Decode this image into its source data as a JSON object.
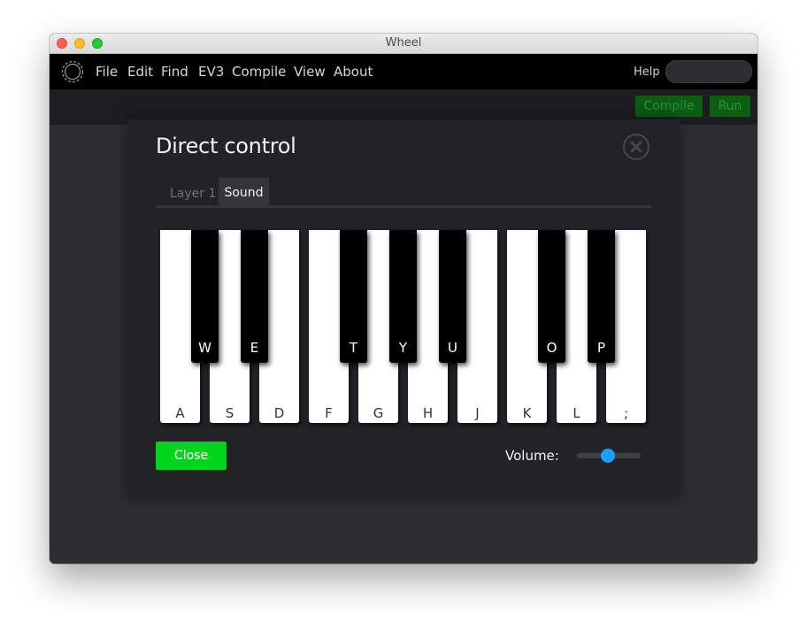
{
  "window": {
    "title": "Wheel"
  },
  "menu": {
    "items": [
      "File",
      "Edit",
      "Find",
      "EV3",
      "Compile",
      "View",
      "About"
    ],
    "help_label": "Help"
  },
  "toolbar": {
    "compile_label": "Compile",
    "run_label": "Run"
  },
  "dialog": {
    "title": "Direct control",
    "tabs": [
      {
        "label": "Layer 1",
        "active": false
      },
      {
        "label": "Sound",
        "active": true
      }
    ],
    "piano": {
      "white_keys": [
        "A",
        "S",
        "D",
        "F",
        "G",
        "H",
        "J",
        "K",
        "L",
        ";"
      ],
      "black_keys": [
        "W",
        "E",
        "T",
        "Y",
        "U",
        "O",
        "P"
      ]
    },
    "close_label": "Close",
    "volume_label": "Volume:",
    "volume_level": 0.48
  },
  "colors": {
    "close_button": "#00d51b",
    "slider_thumb": "#19a0ff",
    "toolbar_button": "#0b5e12"
  }
}
